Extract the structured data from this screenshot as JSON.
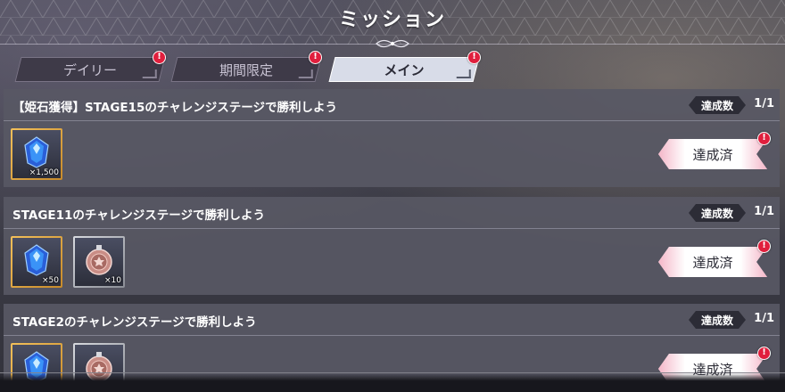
{
  "header": {
    "title": "ミッション"
  },
  "tabs": [
    {
      "label": "デイリー",
      "badge": "!",
      "active": false
    },
    {
      "label": "期間限定",
      "badge": "!",
      "active": false
    },
    {
      "label": "メイン",
      "badge": "!",
      "active": true
    }
  ],
  "missions": [
    {
      "title": "【姫石獲得】STAGE15のチャレンジステージで勝利しよう",
      "count_label": "達成数",
      "count_value": "1/1",
      "rewards": [
        {
          "icon": "blue-gem-icon",
          "qty": "×1,500",
          "frame": "gold"
        }
      ],
      "button_label": "達成済",
      "badge": "!"
    },
    {
      "title": "STAGE11のチャレンジステージで勝利しよう",
      "count_label": "達成数",
      "count_value": "1/1",
      "rewards": [
        {
          "icon": "blue-gem-icon",
          "qty": "×50",
          "frame": "gold"
        },
        {
          "icon": "medal-icon",
          "qty": "×10",
          "frame": "silver"
        }
      ],
      "button_label": "達成済",
      "badge": "!"
    },
    {
      "title": "STAGE2のチャレンジステージで勝利しよう",
      "count_label": "達成数",
      "count_value": "1/1",
      "rewards": [
        {
          "icon": "blue-gem-icon",
          "qty": "",
          "frame": "gold"
        },
        {
          "icon": "medal-icon",
          "qty": "",
          "frame": "silver"
        }
      ],
      "button_label": "達成済",
      "badge": "!"
    }
  ],
  "colors": {
    "badge": "#e01f3d",
    "active_tab": "#d8dce8",
    "panel": "#585864"
  }
}
